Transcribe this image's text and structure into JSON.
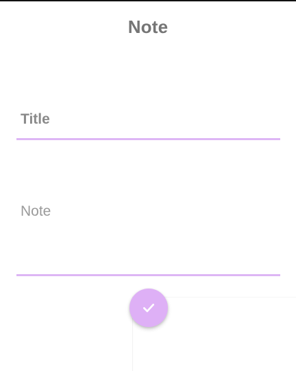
{
  "header": {
    "title": "Note"
  },
  "form": {
    "title_field": {
      "value": "",
      "placeholder": "Title"
    },
    "note_field": {
      "value": "",
      "placeholder": "Note"
    }
  },
  "fab": {
    "icon": "check-icon",
    "color": "#deb0f6"
  },
  "colors": {
    "accent": "#ddb6f5",
    "title_text": "#757575",
    "placeholder": "#9a9a9a"
  }
}
